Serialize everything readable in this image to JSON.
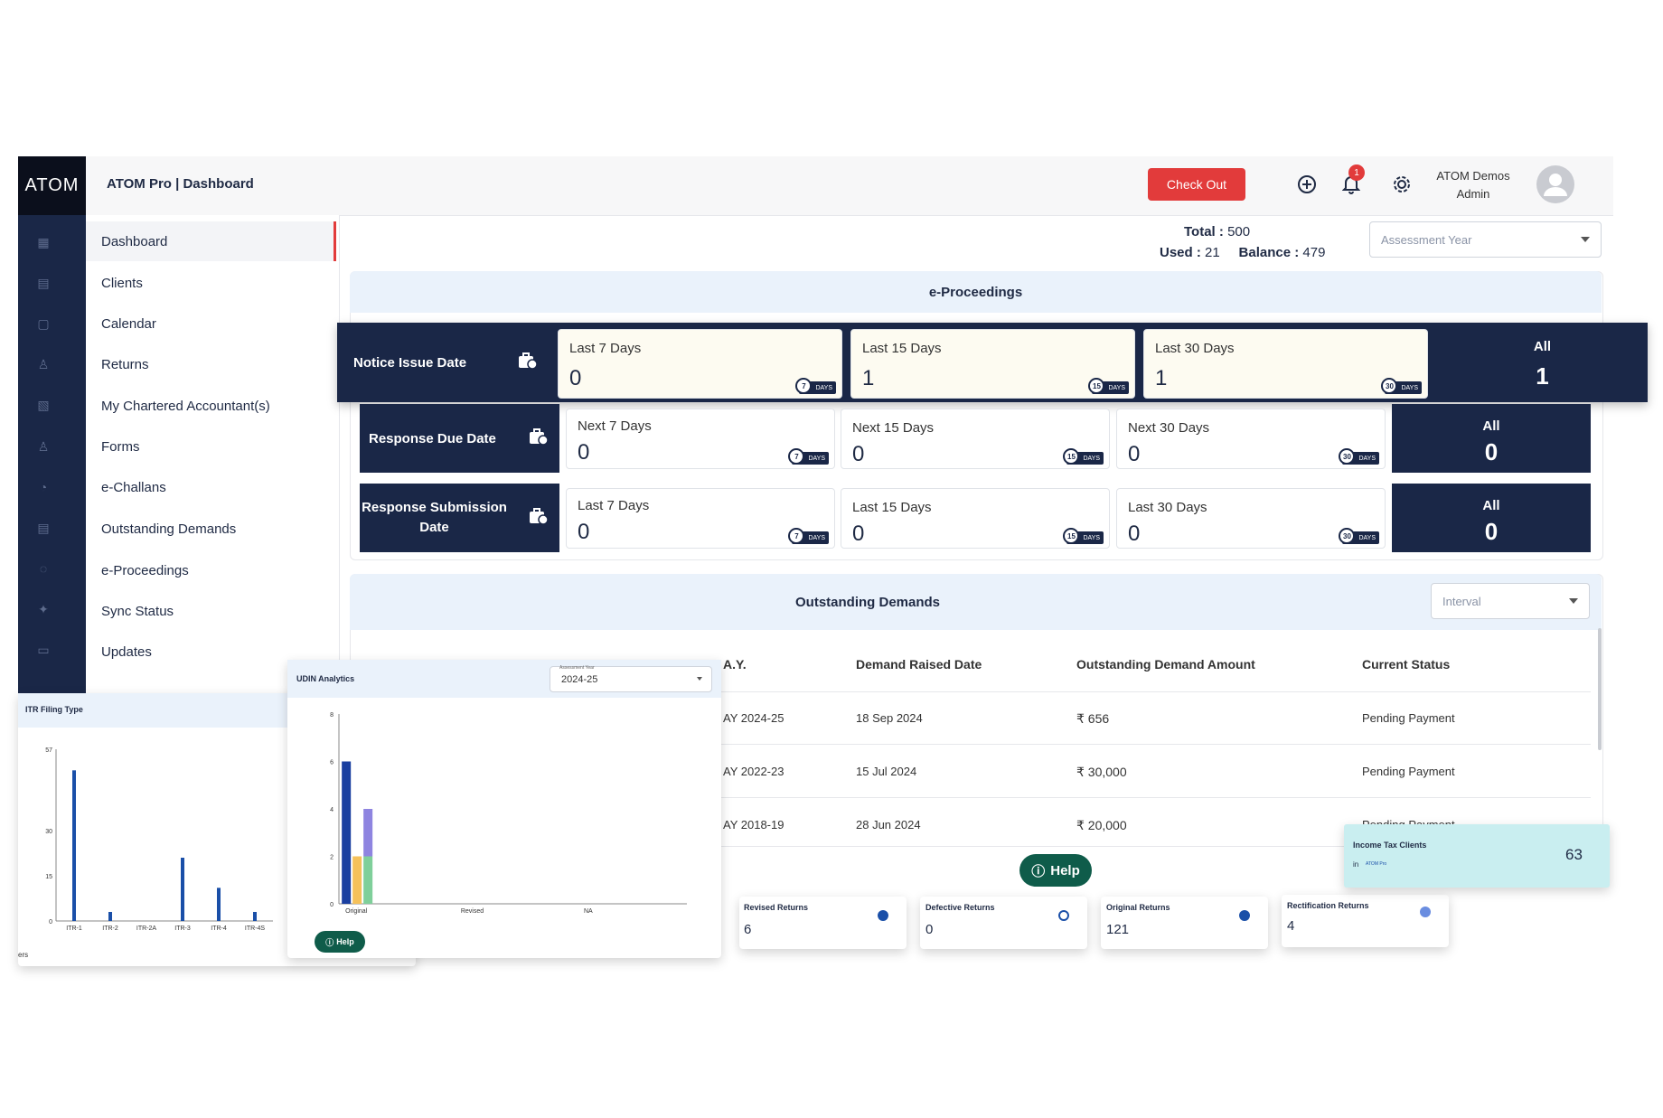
{
  "app": {
    "logo": "ATOM",
    "title": "ATOM Pro | Dashboard",
    "checkout_label": "Check Out",
    "notifications_count": "1",
    "user_name": "ATOM Demos",
    "user_role": "Admin"
  },
  "menu": {
    "items": [
      {
        "label": "Dashboard"
      },
      {
        "label": "Clients"
      },
      {
        "label": "Calendar"
      },
      {
        "label": "Returns"
      },
      {
        "label": "My Chartered Accountant(s)"
      },
      {
        "label": "Forms"
      },
      {
        "label": "e-Challans"
      },
      {
        "label": "Outstanding Demands"
      },
      {
        "label": "e-Proceedings"
      },
      {
        "label": "Sync Status"
      },
      {
        "label": "Updates"
      }
    ]
  },
  "quota": {
    "total_label": "Total :",
    "total_value": "500",
    "used_label": "Used :",
    "used_value": "21",
    "balance_label": "Balance :",
    "balance_value": "479"
  },
  "assessment_year_select": {
    "placeholder": "Assessment Year"
  },
  "eproceedings": {
    "title": "e-Proceedings",
    "days_tag": "DAYS",
    "rows": [
      {
        "label": "Notice Issue Date",
        "cells": [
          {
            "label": "Last 7 Days",
            "value": "0",
            "badge": "7"
          },
          {
            "label": "Last 15 Days",
            "value": "1",
            "badge": "15"
          },
          {
            "label": "Last 30 Days",
            "value": "1",
            "badge": "30"
          }
        ],
        "all_label": "All",
        "all_value": "1"
      },
      {
        "label": "Response Due Date",
        "cells": [
          {
            "label": "Next 7 Days",
            "value": "0",
            "badge": "7"
          },
          {
            "label": "Next 15 Days",
            "value": "0",
            "badge": "15"
          },
          {
            "label": "Next 30 Days",
            "value": "0",
            "badge": "30"
          }
        ],
        "all_label": "All",
        "all_value": "0"
      },
      {
        "label": "Response Submission Date",
        "cells": [
          {
            "label": "Last 7 Days",
            "value": "0",
            "badge": "7"
          },
          {
            "label": "Last 15 Days",
            "value": "0",
            "badge": "15"
          },
          {
            "label": "Last 30 Days",
            "value": "0",
            "badge": "30"
          }
        ],
        "all_label": "All",
        "all_value": "0"
      }
    ]
  },
  "outstanding": {
    "title": "Outstanding Demands",
    "interval_placeholder": "Interval",
    "columns": [
      "A.Y.",
      "Demand Raised Date",
      "Outstanding Demand Amount",
      "Current Status"
    ],
    "rows": [
      {
        "ay": "AY 2024-25",
        "date": "18 Sep 2024",
        "amount": "₹ 656",
        "status": "Pending Payment"
      },
      {
        "ay": "AY 2022-23",
        "date": "15 Jul 2024",
        "amount": "₹ 30,000",
        "status": "Pending Payment"
      },
      {
        "ay": "AY 2018-19",
        "date": "28 Jun 2024",
        "amount": "₹ 20,000",
        "status": "Pending Payment"
      }
    ]
  },
  "itr_card": {
    "title": "ITR Filing Type",
    "footer": "ers"
  },
  "udin_card": {
    "title": "UDIN Analytics",
    "select_label": "Assessment Year",
    "select_value": "2024-25",
    "help_label": "Help"
  },
  "help_label": "Help",
  "stat_cards": [
    {
      "title": "Revised Returns",
      "value": "6"
    },
    {
      "title": "Defective Returns",
      "value": "0"
    },
    {
      "title": "Original Returns",
      "value": "121"
    },
    {
      "title": "Rectification Returns",
      "value": "4"
    }
  ],
  "income_tax_clients": {
    "title": "Income Tax Clients",
    "value": "63",
    "sub": "ATOM Pro"
  },
  "chart_data": [
    {
      "type": "bar",
      "title": "ITR Filing Type",
      "categories": [
        "ITR-1",
        "ITR-2",
        "ITR-2A",
        "ITR-3",
        "ITR-4",
        "ITR-4S"
      ],
      "values": [
        50,
        3,
        0,
        21,
        11,
        3
      ],
      "yticks": [
        0,
        15,
        30,
        57
      ],
      "ylim": [
        0,
        57
      ],
      "color": "#1a4fa8"
    },
    {
      "type": "bar",
      "title": "UDIN Analytics",
      "categories": [
        "Original",
        "Revised",
        "NA"
      ],
      "series": [
        {
          "values": [
            6,
            0,
            0
          ],
          "color": "#1a3fa0"
        },
        {
          "values": [
            2,
            0,
            0
          ],
          "color": "#f5c15a"
        },
        {
          "values": [
            2,
            0,
            0
          ],
          "color": "#7fcf9a",
          "stack_extra": [
            2,
            0,
            0
          ],
          "stack_color": "#8e84e0"
        }
      ],
      "yticks": [
        0,
        2,
        4,
        6,
        8
      ],
      "ylim": [
        0,
        8
      ]
    }
  ]
}
